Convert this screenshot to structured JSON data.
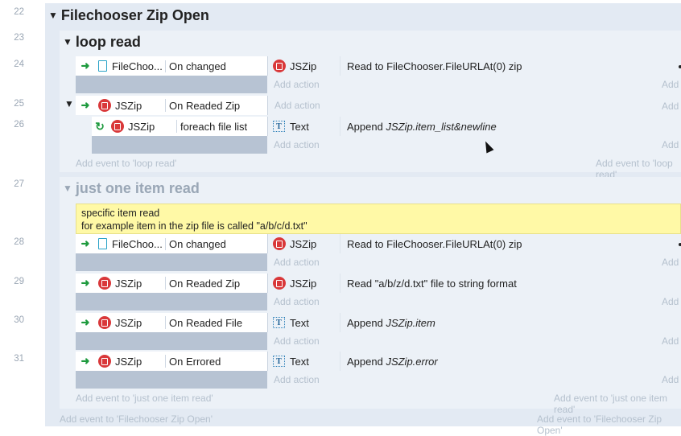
{
  "lines": [
    "22",
    "23",
    "24",
    "25",
    "26",
    "27",
    "28",
    "29",
    "30",
    "31"
  ],
  "groups": {
    "main": {
      "title": "Filechooser Zip Open",
      "add_event": "Add event to 'Filechooser Zip Open'"
    },
    "loop": {
      "title": "loop read",
      "add_event": "Add event to 'loop read'"
    },
    "one": {
      "title": "just one item read",
      "add_event": "Add event to 'just one item read'"
    }
  },
  "comment": {
    "line1": "specific item read",
    "line2": "for example item in the zip file is called \"a/b/c/d.txt\""
  },
  "add_action": "Add action",
  "events": [
    {
      "obj": "FileChoo...",
      "cond": "On changed",
      "act_obj": "JSZip",
      "act": "Read to FileChooser.FileURLAt(0) zip"
    },
    {
      "obj": "JSZip",
      "cond": "On Readed Zip"
    },
    {
      "obj": "JSZip",
      "cond": "foreach file list",
      "act_obj": "Text",
      "act_pre": "Append ",
      "act_em": "JSZip.item_list&newline"
    },
    {
      "obj": "FileChoo...",
      "cond": "On changed",
      "act_obj": "JSZip",
      "act": "Read to FileChooser.FileURLAt(0) zip"
    },
    {
      "obj": "JSZip",
      "cond": "On Readed Zip",
      "act_obj": "JSZip",
      "act": "Read \"a/b/z/d.txt\" file to string format"
    },
    {
      "obj": "JSZip",
      "cond": "On Readed File",
      "act_obj": "Text",
      "act_pre": "Append ",
      "act_em": "JSZip.item"
    },
    {
      "obj": "JSZip",
      "cond": "On Errored",
      "act_obj": "Text",
      "act_pre": "Append ",
      "act_em": "JSZip.error"
    }
  ]
}
